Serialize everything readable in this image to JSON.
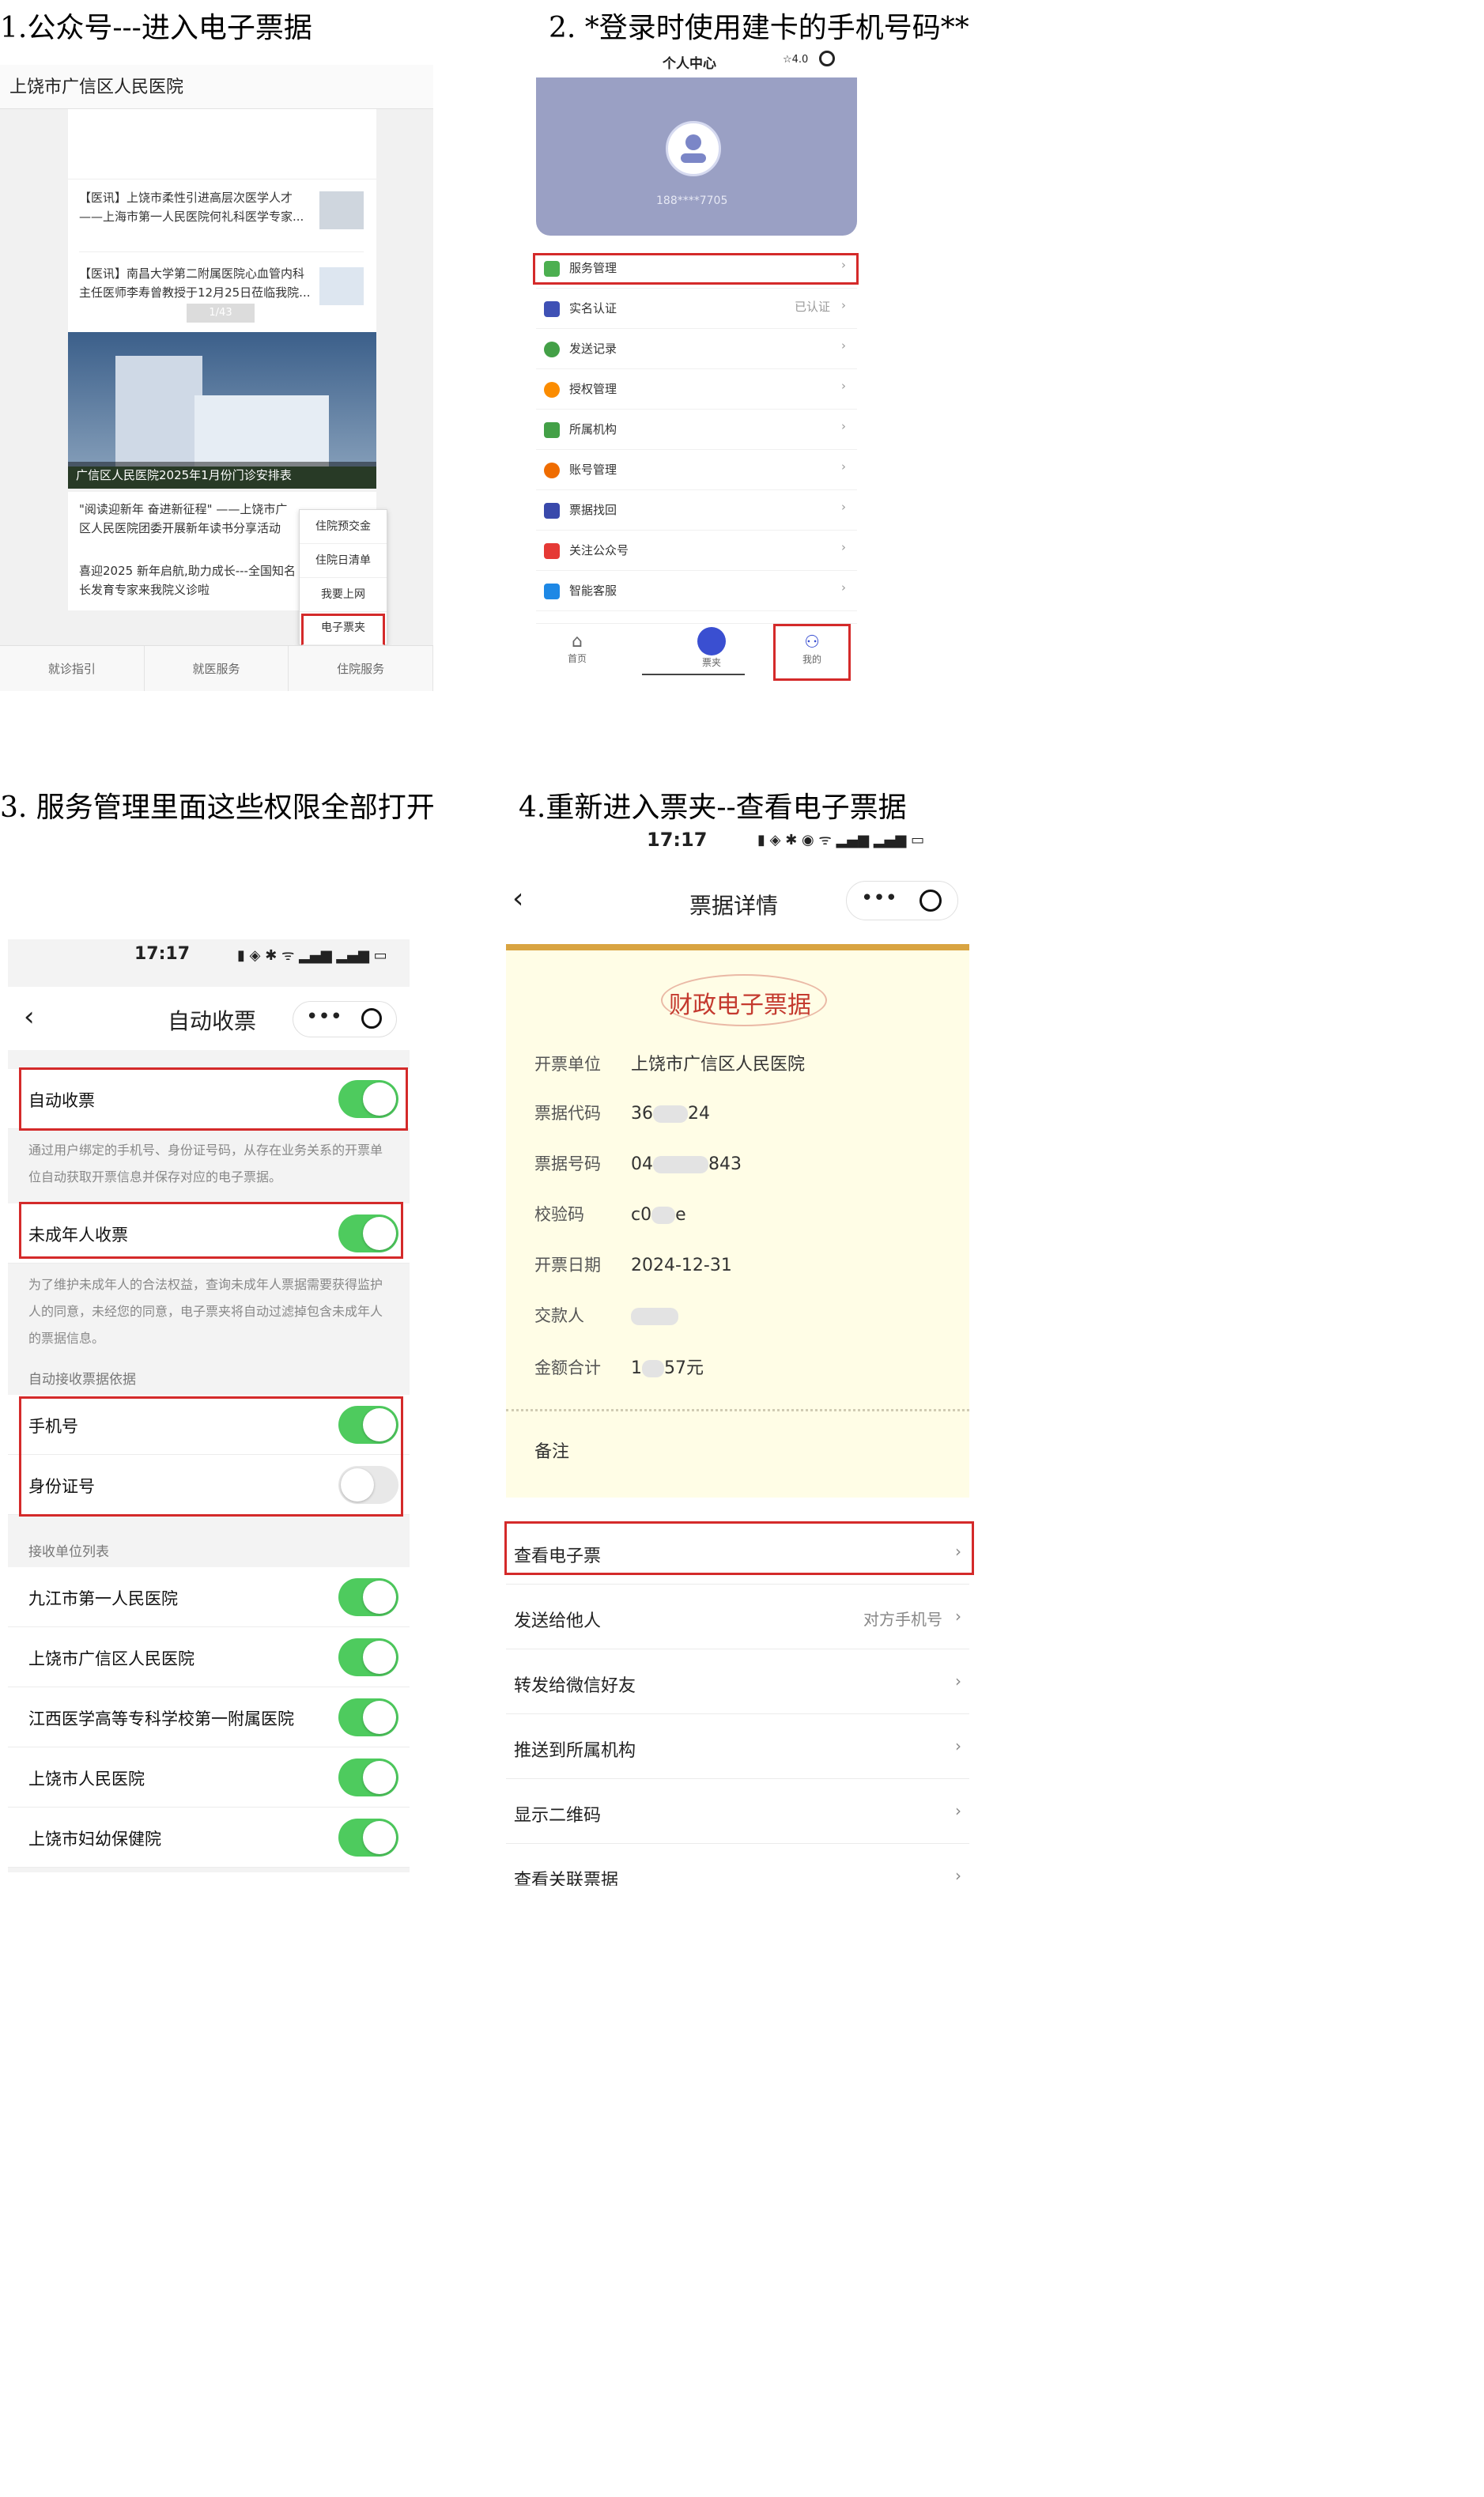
{
  "headings": {
    "step1": "1.公众号---进入电子票据",
    "step2": "2. *登录时使用建卡的手机号码**",
    "step3": "3.  服务管理里面这些权限全部打开",
    "step4": "4.重新进入票夹--查看电子票据"
  },
  "panel1": {
    "title": "上饶市广信区人民医院",
    "news": [
      {
        "line1": "【医讯】上饶市柔性引进高层次医学人才",
        "line2": "——上海市第一人民医院何礼科医学专家..."
      },
      {
        "line1": "【医讯】南昌大学第二附属医院心血管内科",
        "line2": "主任医师李寿曾教授于12月25日莅临我院..."
      }
    ],
    "counter": "1/43",
    "caption": "广信区人民医院2025年1月份门诊安排表",
    "article1": {
      "line1": "\"阅读迎新年 奋进新征程\" ——上饶市广",
      "line2": "区人民医院团委开展新年读书分享活动"
    },
    "article2": {
      "line1": "喜迎2025 新年启航,助力成长---全国知名",
      "line2": "长发育专家来我院义诊啦"
    },
    "menu": [
      "住院预交金",
      "住院日清单",
      "我要上网",
      "电子票夹"
    ],
    "bottom_tabs": [
      "就诊指引",
      "就医服务",
      "住院服务"
    ]
  },
  "panel2": {
    "header_title": "个人中心",
    "rating": "☆4.0",
    "phone": "188****7705",
    "menu": [
      {
        "label": "服务管理",
        "right": "",
        "color": "#4caf50"
      },
      {
        "label": "实名认证",
        "right": "已认证",
        "color": "#3f51b5"
      },
      {
        "label": "发送记录",
        "right": "",
        "color": "#43a047"
      },
      {
        "label": "授权管理",
        "right": "",
        "color": "#fb8c00"
      },
      {
        "label": "所属机构",
        "right": "",
        "color": "#43a047"
      },
      {
        "label": "账号管理",
        "right": "",
        "color": "#ef6c00"
      },
      {
        "label": "票据找回",
        "right": "",
        "color": "#3949ab"
      },
      {
        "label": "关注公众号",
        "right": "",
        "color": "#e53935"
      },
      {
        "label": "智能客服",
        "right": "",
        "color": "#1e88e5"
      }
    ],
    "tabs": [
      "首页",
      "票夹",
      "我的"
    ]
  },
  "panel3": {
    "time": "17:17",
    "title": "自动收票",
    "auto_receive": "自动收票",
    "auto_desc": "通过用户绑定的手机号、身份证号码，从存在业务关系的开票单位自动获取开票信息并保存对应的电子票据。",
    "minor": "未成年人收票",
    "minor_desc": "为了维护未成年人的合法权益，查询未成年人票据需要获得监护人的同意，未经您的同意，电子票夹将自动过滤掉包含未成年人的票据信息。",
    "basis_header": "自动接收票据依据",
    "phone": "手机号",
    "idcard": "身份证号",
    "units_header": "接收单位列表",
    "units": [
      "九江市第一人民医院",
      "上饶市广信区人民医院",
      "江西医学高等专科学校第一附属医院",
      "上饶市人民医院",
      "上饶市妇幼保健院"
    ]
  },
  "panel4": {
    "time": "17:17",
    "title": "票据详情",
    "ticket_title": "财政电子票据",
    "fields": [
      {
        "k": "开票单位",
        "v1": "上饶市广信区人民医院",
        "v2": ""
      },
      {
        "k": "票据代码",
        "v1": "36",
        "v2": "24"
      },
      {
        "k": "票据号码",
        "v1": "04",
        "v2": "843"
      },
      {
        "k": "校验码",
        "v1": "c0",
        "v2": "e"
      },
      {
        "k": "开票日期",
        "v1": "2024-12-31",
        "v2": ""
      },
      {
        "k": "交款人",
        "v1": "",
        "v2": ""
      },
      {
        "k": "金额合计",
        "v1": "1",
        "v2": "57元"
      }
    ],
    "remark": "备注",
    "actions": [
      {
        "label": "查看电子票",
        "right": ""
      },
      {
        "label": "发送给他人",
        "right": "对方手机号"
      },
      {
        "label": "转发给微信好友",
        "right": ""
      },
      {
        "label": "推送到所属机构",
        "right": ""
      },
      {
        "label": "显示二维码",
        "right": ""
      },
      {
        "label": "查看关联票据",
        "right": ""
      }
    ]
  }
}
